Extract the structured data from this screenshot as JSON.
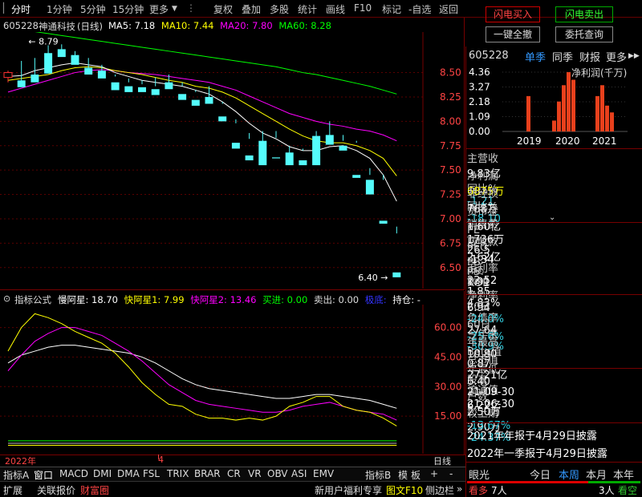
{
  "toolbar": {
    "left_items": [
      "分时",
      "1分钟",
      "5分钟",
      "15分钟",
      "更多",
      "复权",
      "叠加",
      "多股",
      "统计",
      "画线",
      "F10",
      "标记",
      "-自选",
      "返回"
    ],
    "selected_index": 0
  },
  "trade_buttons": {
    "flash_buy": "闪电买入",
    "flash_sell": "闪电卖出",
    "one_click_cancel": "一键全撤",
    "order_query": "委托查询"
  },
  "main_chart": {
    "code": "605228",
    "name": "神通科技",
    "period": "(日线)",
    "ma_labels": [
      {
        "text": "MA5: 7.18",
        "color": "#ffffff"
      },
      {
        "text": "MA10: 7.44",
        "color": "#ffff00"
      },
      {
        "text": "MA20: 7.80",
        "color": "#ff00ff"
      },
      {
        "text": "MA60: 8.28",
        "color": "#00ff00"
      }
    ],
    "y_ticks": [
      "8.50",
      "8.25",
      "8.00",
      "7.75",
      "7.50",
      "7.25",
      "7.00",
      "6.75",
      "6.50"
    ],
    "y_min": 6.4,
    "y_max": 8.79,
    "high_label": "8.79",
    "low_label": "6.40",
    "candles": [
      [
        8.45,
        8.52,
        8.5,
        8.4
      ],
      [
        8.42,
        8.62,
        8.35,
        8.38
      ],
      [
        8.48,
        8.65,
        8.4,
        8.46
      ],
      [
        8.7,
        8.78,
        8.49,
        8.5
      ],
      [
        8.74,
        8.79,
        8.66,
        8.7
      ],
      [
        8.68,
        8.72,
        8.58,
        8.6
      ],
      [
        8.55,
        8.65,
        8.48,
        8.52
      ],
      [
        8.52,
        8.58,
        8.44,
        8.5
      ],
      [
        8.4,
        8.48,
        8.32,
        8.46
      ],
      [
        8.36,
        8.44,
        8.3,
        8.4
      ],
      [
        8.35,
        8.42,
        8.3,
        8.38
      ],
      [
        8.33,
        8.45,
        8.27,
        8.36
      ],
      [
        8.4,
        8.48,
        8.33,
        8.38
      ],
      [
        8.28,
        8.4,
        8.22,
        8.36
      ],
      [
        8.22,
        8.32,
        8.16,
        8.3
      ],
      [
        8.25,
        8.36,
        8.18,
        8.22
      ],
      [
        8.05,
        8.2,
        8.0,
        8.18
      ],
      [
        7.78,
        8.02,
        7.72,
        7.98
      ],
      [
        7.65,
        7.88,
        7.6,
        7.82
      ],
      [
        7.8,
        7.9,
        7.55,
        7.65
      ],
      [
        7.63,
        7.9,
        7.62,
        7.83
      ],
      [
        7.68,
        7.75,
        7.55,
        7.65
      ],
      [
        7.6,
        7.72,
        7.55,
        7.7
      ],
      [
        7.85,
        7.9,
        7.55,
        7.6
      ],
      [
        7.86,
        8.0,
        7.76,
        7.8
      ],
      [
        7.75,
        7.86,
        7.7,
        7.8
      ],
      [
        7.45,
        7.8,
        7.42,
        7.78
      ],
      [
        7.4,
        7.52,
        7.25,
        7.45
      ],
      [
        6.98,
        7.45,
        6.95,
        7.4
      ],
      [
        6.45,
        6.92,
        6.4,
        6.85
      ]
    ],
    "ma5": [
      8.46,
      8.47,
      8.52,
      8.55,
      8.58,
      8.6,
      8.58,
      8.56,
      8.5,
      8.46,
      8.42,
      8.4,
      8.38,
      8.36,
      8.32,
      8.28,
      8.2,
      8.1,
      7.98,
      7.88,
      7.82,
      7.74,
      7.7,
      7.7,
      7.74,
      7.75,
      7.7,
      7.62,
      7.45,
      7.18
    ],
    "ma10": [
      8.42,
      8.44,
      8.46,
      8.48,
      8.52,
      8.55,
      8.56,
      8.55,
      8.52,
      8.5,
      8.48,
      8.45,
      8.42,
      8.4,
      8.36,
      8.34,
      8.3,
      8.24,
      8.16,
      8.08,
      8.0,
      7.92,
      7.85,
      7.8,
      7.78,
      7.78,
      7.75,
      7.7,
      7.62,
      7.44
    ],
    "ma20": [
      8.3,
      8.34,
      8.38,
      8.42,
      8.46,
      8.5,
      8.52,
      8.53,
      8.52,
      8.5,
      8.49,
      8.48,
      8.46,
      8.44,
      8.42,
      8.4,
      8.36,
      8.32,
      8.26,
      8.2,
      8.14,
      8.08,
      8.04,
      8.0,
      7.97,
      7.95,
      7.92,
      7.9,
      7.86,
      7.8
    ],
    "ma60": [
      8.95,
      8.93,
      8.92,
      8.9,
      8.88,
      8.86,
      8.84,
      8.82,
      8.8,
      8.78,
      8.76,
      8.74,
      8.72,
      8.7,
      8.68,
      8.66,
      8.64,
      8.62,
      8.6,
      8.58,
      8.56,
      8.53,
      8.5,
      8.48,
      8.45,
      8.42,
      8.39,
      8.36,
      8.32,
      8.28
    ]
  },
  "indicator": {
    "title": "指标公式",
    "values": [
      {
        "text": "慢阿星: 18.70",
        "color": "#ffffff"
      },
      {
        "text": "快阿星1: 7.99",
        "color": "#ffff00"
      },
      {
        "text": "快阿星2: 13.46",
        "color": "#ff00ff"
      },
      {
        "text": "买进: 0.00",
        "color": "#00ff00"
      },
      {
        "text": "卖出: 0.00",
        "color": "#c0c0c0"
      },
      {
        "text": "极底: ",
        "color": "#0000ff"
      },
      {
        "text": "持仓: -",
        "color": "#ffffff"
      }
    ],
    "y_ticks": [
      "60.00",
      "45.00",
      "30.00",
      "15.00"
    ],
    "y_min": 0,
    "y_max": 70,
    "slow": [
      42,
      46,
      48,
      50,
      51,
      51,
      50,
      49,
      48,
      47,
      45,
      42,
      38,
      34,
      31,
      29,
      28,
      27,
      26,
      25,
      24,
      24,
      25,
      26,
      26,
      25,
      24,
      23,
      21,
      19
    ],
    "fast1": [
      48,
      60,
      67,
      65,
      62,
      58,
      55,
      52,
      47,
      40,
      32,
      26,
      21,
      20,
      16,
      14,
      14,
      13,
      14,
      13,
      15,
      20,
      22,
      25,
      25,
      20,
      18,
      17,
      14,
      10
    ],
    "fast2": [
      38,
      46,
      53,
      57,
      60,
      60,
      58,
      56,
      52,
      48,
      43,
      37,
      31,
      27,
      23,
      21,
      20,
      19,
      18,
      17,
      17,
      18,
      20,
      21,
      22,
      20,
      18,
      17,
      16,
      13
    ]
  },
  "date_axis": {
    "labels": [
      "2022年",
      "4"
    ],
    "period": "日线"
  },
  "indicator_tabs": [
    "指标A",
    "窗口",
    "MACD",
    "DMI",
    "DMA",
    "FSL",
    "TRIX",
    "BRAR",
    "CR",
    "VR",
    "OBV",
    "ASI",
    "EMV"
  ],
  "indicator_tabs_right": [
    "指标B",
    "模",
    "板",
    "+",
    "-"
  ],
  "status_bar": {
    "items": [
      "扩展",
      "关联报价",
      "财富圈"
    ],
    "right_items": [
      "新用户福利专享",
      "图文F10",
      "侧边栏"
    ]
  },
  "finance_panel": {
    "code": "605228",
    "tabs": [
      "单季",
      "同季",
      "财报",
      "更多"
    ],
    "net_profit_label": "净利润(千万)",
    "y_ticks": [
      "4.36",
      "3.27",
      "2.18",
      "1.09",
      "0.00"
    ],
    "years": [
      "2019",
      "2020",
      "2021"
    ],
    "bars": [
      2.6,
      0.8,
      2.2,
      3.4,
      4.36,
      3.8,
      2.6,
      3.4,
      1.9,
      1.4
    ],
    "bar_max": 4.36
  },
  "stats_rows": [
    {
      "k1": "主营收",
      "v1": "9.83亿",
      "k2": "同比%",
      "v2": "-1.21"
    },
    {
      "k1": "净利润",
      "v1": "6875万",
      "k2": "同比%",
      "v2": "-18.10"
    },
    {
      "k1": "非经损",
      "v1": "768万",
      "k2": "销售费",
      "v2": "1736万"
    },
    {
      "k1": "货币金",
      "v1": "1.60亿",
      "k2": "应收款",
      "v2": "2.62亿"
    }
  ],
  "valuation_rows": [
    {
      "k1": "PE",
      "sup1": "TTM",
      "v1": "26.5",
      "k2": "PB",
      "sup2": "MRQ",
      "v2": "1.91"
    },
    {
      "k1": "PEG",
      "sup1": "",
      "v1": "-1.34",
      "k2": "PS",
      "sup2": "TTM",
      "v2": "1.85"
    },
    {
      "k1": "毛利率",
      "sup1": "",
      "v1": "22.52",
      "k2": "净利率",
      "sup2": "",
      "v2": "6.94"
    },
    {
      "k1": "ROE",
      "sup1": "⑤",
      "v1": "4.83%",
      "k2": "负债率",
      "sup2": "",
      "v2": "27.64"
    }
  ],
  "perf_rows": [
    {
      "k1": "20日",
      "v1": "-24.0%",
      "k2": "今年来",
      "v2": "-30.9%"
    },
    {
      "k1": "60日",
      "v1": "-25.6%",
      "k2": "Beta值",
      "v2": "0.87"
    },
    {
      "k1": "年最高",
      "v1": "10.80",
      "k2": "年最低",
      "v2": "6.40"
    },
    {
      "k1": "总市值",
      "v1": "27.21亿",
      "k2": "流通值",
      "v2": "6.22亿"
    }
  ],
  "holder_rows": [
    {
      "k1": "股东",
      "v1": "21-09-30",
      "v2": "21-06-30"
    },
    {
      "k1": "户数",
      "v1": "2.50万",
      "v2": "2.90万"
    },
    {
      "k1": "较上期",
      "v1": "-13.67%",
      "v2": "-24.37%"
    }
  ],
  "reports": [
    "2021年年报于4月29日披露",
    "2022年一季报于4月29日披露"
  ],
  "eye_light": {
    "title": "眼光",
    "tabs": [
      "今日",
      "本周",
      "本月",
      "本年"
    ],
    "bull_label": "看多",
    "bull_count": "7人",
    "bear_count": "3人",
    "bear_label": "看空"
  }
}
